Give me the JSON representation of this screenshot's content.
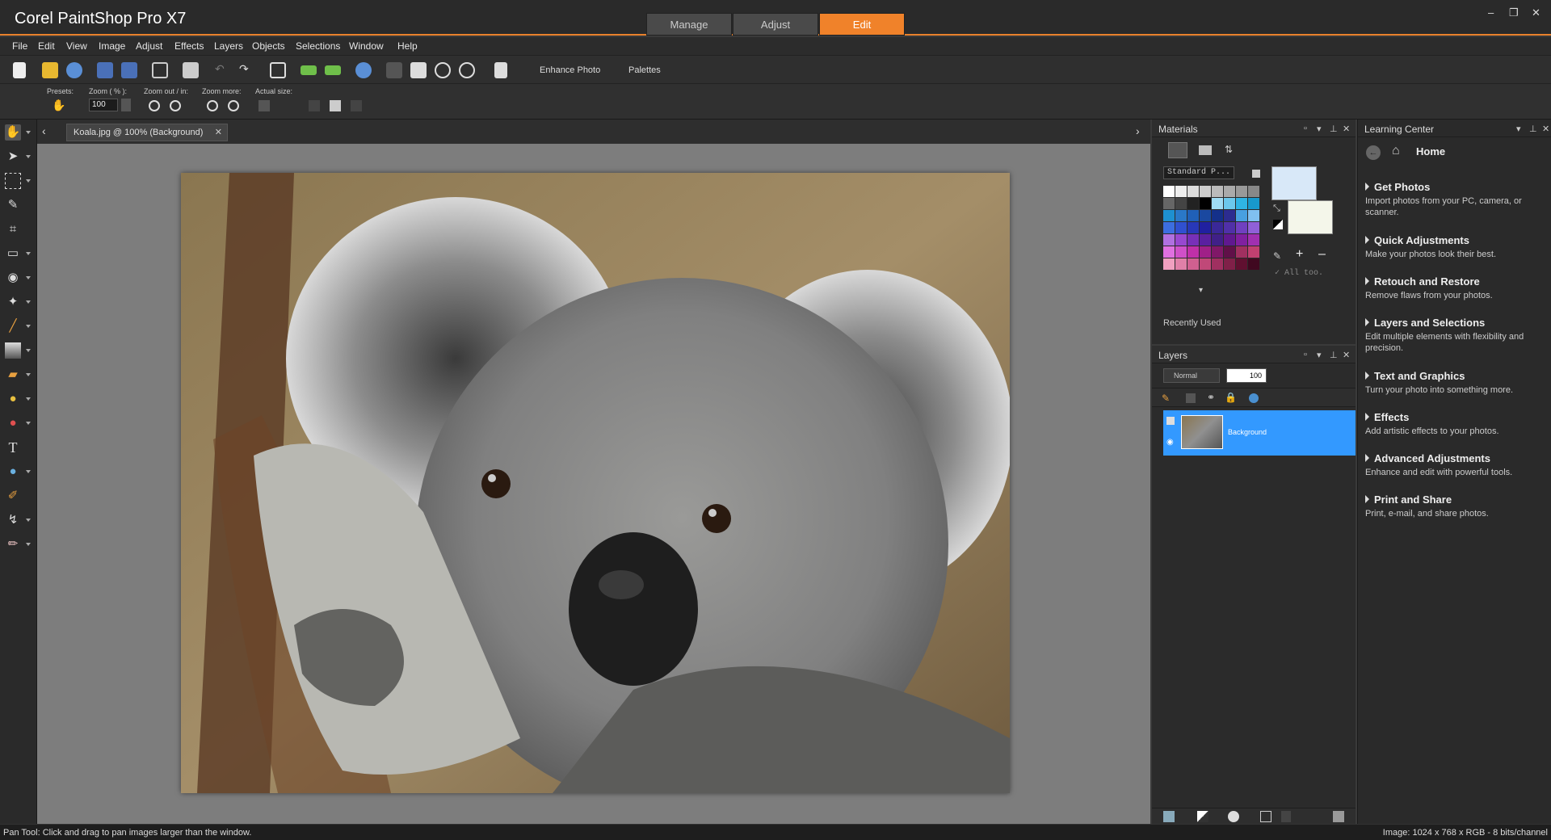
{
  "app": {
    "title": "Corel PaintShop Pro X7"
  },
  "workspace_tabs": [
    {
      "label": "Manage"
    },
    {
      "label": "Adjust"
    },
    {
      "label": "Edit"
    }
  ],
  "window_controls": {
    "minimize": "–",
    "restore": "❐",
    "close": "✕"
  },
  "menu": [
    {
      "label": "File"
    },
    {
      "label": "Edit"
    },
    {
      "label": "View"
    },
    {
      "label": "Image"
    },
    {
      "label": "Adjust"
    },
    {
      "label": "Effects"
    },
    {
      "label": "Layers"
    },
    {
      "label": "Objects"
    },
    {
      "label": "Selections"
    },
    {
      "label": "Window"
    },
    {
      "label": "Help"
    }
  ],
  "toolbar": {
    "enhance_photo": "Enhance Photo",
    "palettes": "Palettes"
  },
  "tool_options": {
    "presets_label": "Presets:",
    "zoom_label": "Zoom ( % ):",
    "zoom_value": "100",
    "zoom_out_in_label": "Zoom out / in:",
    "zoom_more_label": "Zoom more:",
    "actual_size_label": "Actual size:"
  },
  "document": {
    "tab_label": "Koala.jpg @ 100% (Background)"
  },
  "materials": {
    "title": "Materials",
    "swatch_set": "Standard P...",
    "all_tools": "All too.",
    "recently_used": "Recently Used",
    "foreground_color": "#d8e8f8",
    "background_color": "#f4f6ea"
  },
  "layers": {
    "title": "Layers",
    "blend_mode": "Normal",
    "opacity": "100",
    "items": [
      {
        "name": "Background"
      }
    ]
  },
  "learning_center": {
    "title": "Learning Center",
    "home": "Home",
    "items": [
      {
        "title": "Get Photos",
        "desc": "Import photos from your PC, camera, or scanner."
      },
      {
        "title": "Quick Adjustments",
        "desc": "Make your photos look their best."
      },
      {
        "title": "Retouch and Restore",
        "desc": "Remove flaws from your photos."
      },
      {
        "title": "Layers and Selections",
        "desc": "Edit multiple elements with flexibility and precision."
      },
      {
        "title": "Text and Graphics",
        "desc": "Turn your photo into something more."
      },
      {
        "title": "Effects",
        "desc": "Add artistic effects to your photos."
      },
      {
        "title": "Advanced Adjustments",
        "desc": "Enhance and edit with powerful tools."
      },
      {
        "title": "Print and Share",
        "desc": "Print, e-mail, and share photos."
      }
    ]
  },
  "status": {
    "left": "Pan Tool: Click and drag to pan images larger than the window.",
    "right": "Image:  1024 x 768 x RGB - 8 bits/channel"
  },
  "colors": {
    "accent": "#f0822a",
    "layer_selected": "#3399ff"
  }
}
